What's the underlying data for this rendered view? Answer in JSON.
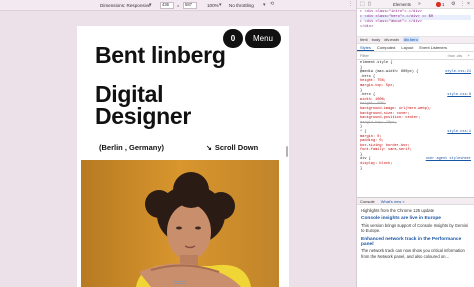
{
  "toolbar": {
    "dimensions_label": "Dimensions: Responsive",
    "width": "436",
    "height": "587",
    "zoom": "100%",
    "throttle": "No throttling"
  },
  "page": {
    "cart_count": "0",
    "menu_label": "Menu",
    "name": "Bent linberg",
    "title_line1": "Digital",
    "title_line2": "Designer",
    "location": "(Berlin , Germany)",
    "scroll_arrow": "↘",
    "scroll_label": "Scroll Down"
  },
  "devtools": {
    "elements_tab": "Elements",
    "error_count": "1",
    "dom_lines": [
      "▸ <div class=\"intro\">…</div>",
      "▸ <div class=\"hero\">…</div> == $0",
      "▸ <div class=\"about\">…</div>",
      "</div>"
    ],
    "breadcrumb": [
      "html",
      "body",
      "div.main",
      "div.hero"
    ],
    "panel_tabs": [
      "Styles",
      "Computed",
      "Layout",
      "Event Listeners"
    ],
    "filter_placeholder": "Filter",
    "filter_hint": ":hov .cls",
    "style_lines": [
      {
        "t": "element.style {",
        "c": "sel"
      },
      {
        "t": "}",
        "c": "sel"
      },
      {
        "t": "@media (max-width: 600px) {",
        "c": "sel",
        "src": "style.css:21"
      },
      {
        "t": ".hero {",
        "c": "sel"
      },
      {
        "t": "  height: 75%;",
        "c": "prop"
      },
      {
        "t": "  margin-top: 5px;",
        "c": "prop"
      },
      {
        "t": "}",
        "c": "sel"
      },
      {
        "t": ".hero {",
        "c": "sel",
        "src": "style.css:8"
      },
      {
        "t": "  width: 100%;",
        "c": "prop"
      },
      {
        "t": "  height: 60%;",
        "c": "strike"
      },
      {
        "t": "  background-image: url(hero.webp);",
        "c": "prop"
      },
      {
        "t": "  background-size: cover;",
        "c": "prop"
      },
      {
        "t": "  background-position: center;",
        "c": "prop"
      },
      {
        "t": "  margin-top: 10px;",
        "c": "strike"
      },
      {
        "t": "}",
        "c": "sel"
      },
      {
        "t": "* {",
        "c": "sel",
        "src": "style.css:1"
      },
      {
        "t": "  margin: 0;",
        "c": "prop"
      },
      {
        "t": "  padding: 0;",
        "c": "prop"
      },
      {
        "t": "  box-sizing: border-box;",
        "c": "prop"
      },
      {
        "t": "  font-family: sans-serif;",
        "c": "prop"
      },
      {
        "t": "}",
        "c": "sel"
      },
      {
        "t": "div {",
        "c": "sel",
        "src": "user agent stylesheet"
      },
      {
        "t": "  display: block;",
        "c": "prop"
      },
      {
        "t": "}",
        "c": "sel"
      }
    ],
    "console_tabs": [
      "Console",
      "What's new ×"
    ],
    "console_intro": "Highlights from the Chrome 125 update",
    "console_items": [
      {
        "h": "Console insights are live in Europe",
        "p": "This version brings support of Console Insights by Gemini to Europe."
      },
      {
        "h": "Enhanced network track in the Performance panel",
        "p": "The network track can now show you critical information from the Network panel, and also coloured on..."
      }
    ]
  },
  "colors": {
    "accent": "#1a56a6",
    "page_bg": "#ede2ea",
    "button_bg": "#111111"
  }
}
